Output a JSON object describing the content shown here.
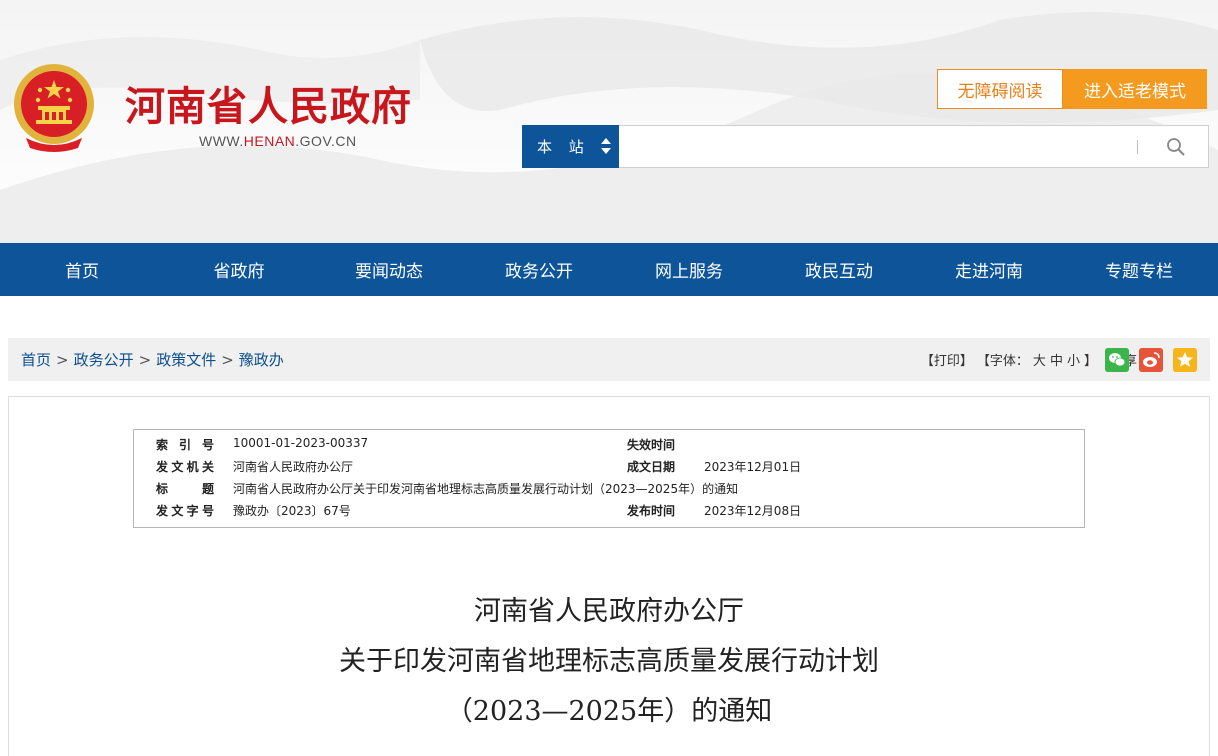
{
  "header": {
    "site_name": "河南省人民政府",
    "url_prefix": "WWW.",
    "url_accent": "HENAN",
    "url_suffix": ".GOV.CN",
    "accessibility_label": "无障碍阅读",
    "elder_mode_label": "进入适老模式",
    "search": {
      "scope": "本 站",
      "placeholder": ""
    }
  },
  "nav": [
    "首页",
    "省政府",
    "要闻动态",
    "政务公开",
    "网上服务",
    "政民互动",
    "走进河南",
    "专题专栏"
  ],
  "breadcrumb": [
    "首页",
    "政务公开",
    "政策文件",
    "豫政办"
  ],
  "tools": {
    "print": "【打印】",
    "font_open": "【字体：",
    "font_large": "大",
    "font_medium": "中",
    "font_small": "小",
    "font_close": "】",
    "share": "分享："
  },
  "meta": {
    "index_label": "索引号",
    "index_value": "10001-01-2023-00337",
    "expire_label": "失效时间",
    "expire_value": "",
    "issuer_label": "发文机关",
    "issuer_value": "河南省人民政府办公厅",
    "made_label": "成文日期",
    "made_value": "2023年12月01日",
    "title_label": "标题",
    "title_value": "河南省人民政府办公厅关于印发河南省地理标志高质量发展行动计划（2023—2025年）的通知",
    "docno_label": "发文字号",
    "docno_value": "豫政办〔2023〕67号",
    "publish_label": "发布时间",
    "publish_value": "2023年12月08日"
  },
  "document_title": {
    "line1": "河南省人民政府办公厅",
    "line2": "关于印发河南省地理标志高质量发展行动计划",
    "line3": "（2023—2025年）的通知"
  },
  "colors": {
    "brand_red": "#c8161d",
    "nav_blue": "#0d5598",
    "orange": "#f39a1f",
    "link_blue": "#0d4f91"
  }
}
